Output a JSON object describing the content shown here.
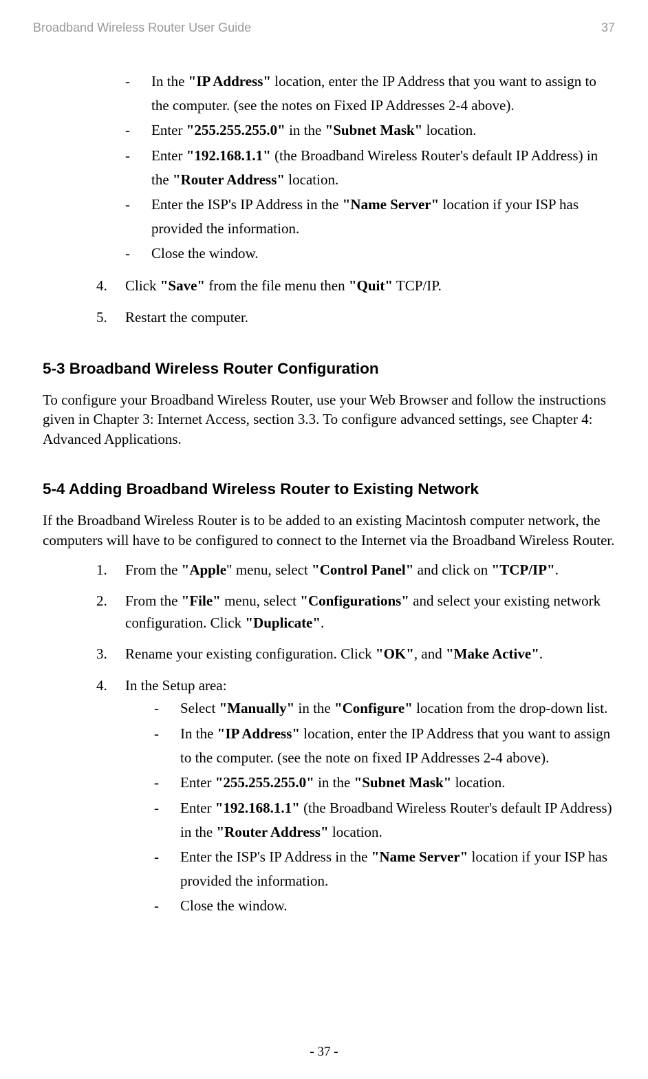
{
  "header": {
    "title": "Broadband Wireless Router User Guide",
    "page_num": "37"
  },
  "top_dash_items": [
    {
      "prefix": "In the ",
      "b1": "\"IP Address\"",
      "mid1": " location, enter the IP Address that you want to assign to the computer. (see the notes on Fixed IP Addresses 2-4 above)."
    },
    {
      "prefix": "Enter ",
      "b1": "\"255.255.255.0\"",
      "mid1": " in the ",
      "b2": "\"Subnet Mask\"",
      "mid2": " location."
    },
    {
      "prefix": "Enter ",
      "b1": "\"192.168.1.1\"",
      "mid1": " (the Broadband Wireless Router's default IP Address) in the ",
      "b2": "\"Router Address\"",
      "mid2": " location."
    },
    {
      "prefix": "Enter the ISP's IP Address in the ",
      "b1": "\"Name Server\"",
      "mid1": " location if your ISP has provided the information."
    },
    {
      "prefix": "Close the window."
    }
  ],
  "top_num_items": [
    {
      "num": "4.",
      "prefix": "Click ",
      "b1": "\"Save\"",
      "mid1": " from the file menu then ",
      "b2": "\"Quit\"",
      "mid2": " TCP/IP."
    },
    {
      "num": "5.",
      "prefix": "Restart the computer."
    }
  ],
  "section_53": {
    "heading": "5-3 Broadband Wireless Router Configuration",
    "para": "To configure your Broadband Wireless Router, use your Web Browser and follow the instructions given in Chapter 3: Internet Access, section 3.3. To configure advanced settings, see Chapter 4: Advanced Applications."
  },
  "section_54": {
    "heading": "5-4 Adding Broadband Wireless Router to Existing Network",
    "para": "If the Broadband Wireless Router is to be added to an existing Macintosh computer network, the computers will have to be configured to connect to the Internet via the Broadband Wireless Router.",
    "steps": [
      {
        "num": "1.",
        "prefix": "From the ",
        "b1": "\"Apple",
        "mid1": "\" menu, select ",
        "b2": "\"Control Panel\"",
        "mid2": " and click on ",
        "b3": "\"TCP/IP\"",
        "mid3": "."
      },
      {
        "num": "2.",
        "prefix": "From the ",
        "b1": "\"File\"",
        "mid1": " menu, select ",
        "b2": "\"Configurations\"",
        "mid2": " and select your existing network configuration. Click ",
        "b3": "\"Duplicate\"",
        "mid3": "."
      },
      {
        "num": "3.",
        "prefix": "Rename your existing configuration. Click ",
        "b1": "\"OK\"",
        "mid1": ", and ",
        "b2": "\"Make Active\"",
        "mid2": "."
      },
      {
        "num": "4.",
        "prefix": "In the Setup area:"
      }
    ],
    "sub_dashes": [
      {
        "prefix": "Select ",
        "b1": "\"Manually\"",
        "mid1": " in the ",
        "b2": "\"Configure\"",
        "mid2": " location from the drop-down list."
      },
      {
        "prefix": "In the ",
        "b1": "\"IP Address\"",
        "mid1": " location, enter the IP Address that you want to assign to the computer. (see the note on fixed IP Addresses 2-4 above)."
      },
      {
        "prefix": "Enter ",
        "b1": "\"255.255.255.0\"",
        "mid1": " in the ",
        "b2": "\"Subnet Mask\"",
        "mid2": " location."
      },
      {
        "prefix": "Enter ",
        "b1": "\"192.168.1.1\"",
        "mid1": " (the Broadband Wireless Router's default IP Address) in the ",
        "b2": "\"Router Address\"",
        "mid2": " location."
      },
      {
        "prefix": "Enter the ISP's IP Address in the ",
        "b1": "\"Name Server\"",
        "mid1": " location if your ISP has provided the information."
      },
      {
        "prefix": "Close the window."
      }
    ]
  },
  "footer": "- 37 -"
}
